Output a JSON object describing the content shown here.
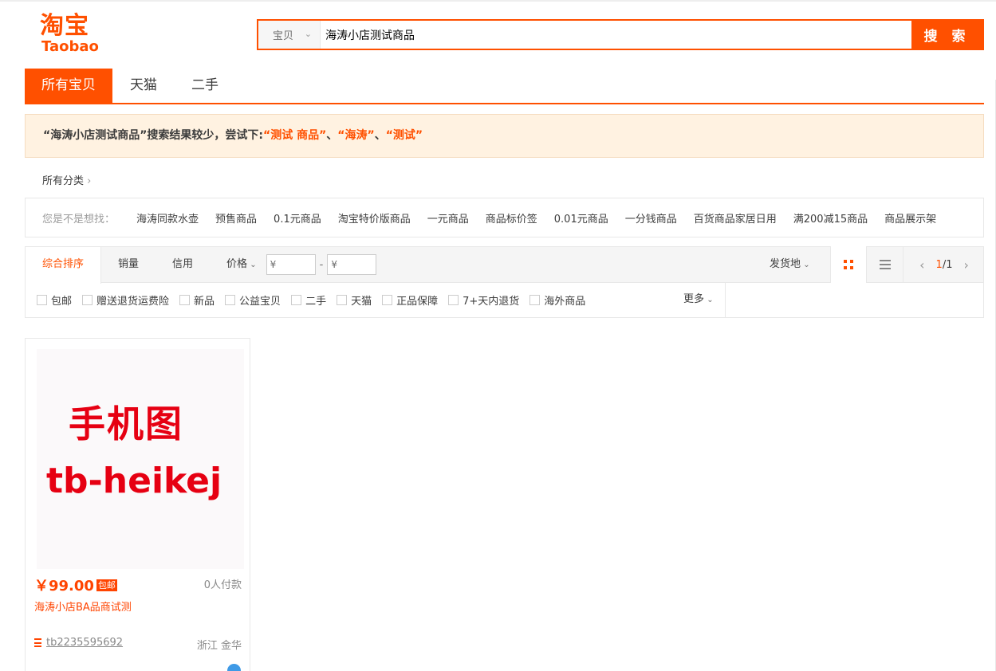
{
  "logo": {
    "cn": "淘宝",
    "en": "Taobao"
  },
  "search": {
    "category": "宝贝",
    "query": "海涛小店测试商品",
    "button": "搜 索"
  },
  "tabs": [
    {
      "label": "所有宝贝"
    },
    {
      "label": "天猫"
    },
    {
      "label": "二手"
    }
  ],
  "tip": {
    "prefix": "“海涛小店测试商品”搜索结果较少，尝试下:",
    "s1": "“测试 商品”",
    "sep1": "、",
    "s2": "“海涛”",
    "sep2": "、",
    "s3": "“测试”"
  },
  "category": {
    "label": "所有分类",
    "chevron": "›"
  },
  "suggest": {
    "label": "您是不是想找：",
    "items": [
      "海涛同款水壶",
      "预售商品",
      "0.1元商品",
      "淘宝特价版商品",
      "一元商品",
      "商品标价签",
      "0.01元商品",
      "一分钱商品",
      "百货商品家居日用",
      "满200减15商品",
      "商品展示架"
    ]
  },
  "sort": {
    "items": [
      "综合排序",
      "销量",
      "信用"
    ],
    "price_label": "价格",
    "price_min": "¥",
    "price_max": "¥",
    "dash": "-",
    "origin": "发货地",
    "pager": {
      "current": "1",
      "total": "/1"
    }
  },
  "filters": {
    "items": [
      "包邮",
      "赠送退货运费险",
      "新品",
      "公益宝贝",
      "二手",
      "天猫",
      "正品保障",
      "7+天内退货",
      "海外商品"
    ],
    "more": "更多"
  },
  "product": {
    "image_text_1": "手机图",
    "image_text_2": "tb-heikej",
    "price": "￥99.00",
    "badge": "包邮",
    "sales": "0人付款",
    "title": "海涛小店BA品商试测",
    "seller": "tb2235595692",
    "location": "浙江 金华"
  },
  "colors": {
    "accent": "#ff5000",
    "price": "#ff4400",
    "tip_bg": "#fff2e1"
  }
}
